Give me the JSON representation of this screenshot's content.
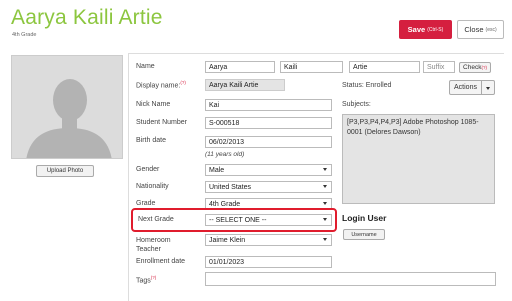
{
  "header": {
    "student_name": "Aarya Kaili Artie",
    "grade_label": "4th Grade",
    "save_label": "Save",
    "save_shortcut": "(Ctrl-S)",
    "close_label": "Close",
    "close_shortcut": "(esc)"
  },
  "photo": {
    "upload_label": "Upload Photo"
  },
  "form": {
    "name_label": "Name",
    "first_name": "Aarya",
    "middle_name": "Kaili",
    "last_name": "Artie",
    "suffix_placeholder": "Suffix",
    "check_label": "Check",
    "display_name_label": "Display name:",
    "display_name_value": "Aarya Kaili Artie",
    "nick_name_label": "Nick Name",
    "nick_name_value": "Kai",
    "student_number_label": "Student Number",
    "student_number_value": "S-000518",
    "birth_date_label": "Birth date",
    "birth_date_value": "06/02/2013",
    "age_text": "(11 years old)",
    "gender_label": "Gender",
    "gender_value": "Male",
    "nationality_label": "Nationality",
    "nationality_value": "United States",
    "grade_label": "Grade",
    "grade_value": "4th Grade",
    "next_grade_label": "Next Grade",
    "next_grade_value": "-- SELECT ONE --",
    "homeroom_label": "Homeroom Teacher",
    "homeroom_value": "Jaime Klein",
    "enrollment_label": "Enrollment date",
    "enrollment_value": "01/01/2023",
    "tags_label": "Tags"
  },
  "status": {
    "status_text": "Status: Enrolled",
    "actions_label": "Actions",
    "subjects_label": "Subjects:",
    "subjects_text": "[P3,P3,P4,P4,P3] Adobe Photoshop 1085-0001 (Delores Dawson)"
  },
  "login": {
    "title": "Login User",
    "username_button": "Username"
  },
  "colors": {
    "accent_green": "#8cc63f",
    "save_red": "#d51f3f",
    "highlight_red": "#e01c2d"
  }
}
